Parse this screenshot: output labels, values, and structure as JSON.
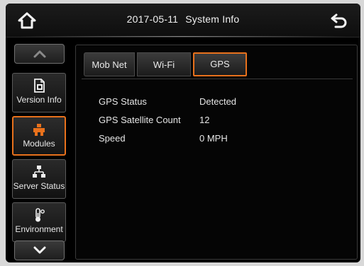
{
  "header": {
    "date": "2017-05-11",
    "title": "System Info",
    "home_icon": "home-icon",
    "back_icon": "back-arrow-icon"
  },
  "sidebar": {
    "items": [
      {
        "label": "Version Info",
        "icon": "document-icon"
      },
      {
        "label": "Modules",
        "icon": "modules-icon",
        "active": true
      },
      {
        "label": "Server Status",
        "icon": "network-icon"
      },
      {
        "label": "Environment",
        "icon": "thermometer-icon"
      }
    ],
    "up_icon": "chevron-up-icon",
    "down_icon": "chevron-down-icon"
  },
  "tabs": [
    {
      "label": "Mob Net"
    },
    {
      "label": "Wi-Fi"
    },
    {
      "label": "GPS",
      "active": true
    }
  ],
  "gps": {
    "rows": [
      {
        "key": "GPS Status",
        "value": "Detected"
      },
      {
        "key": "GPS Satellite Count",
        "value": "12"
      },
      {
        "key": "Speed",
        "value": "0 MPH"
      }
    ]
  },
  "colors": {
    "accent": "#e8711c",
    "background": "#000000",
    "text": "#e8e8e8"
  }
}
